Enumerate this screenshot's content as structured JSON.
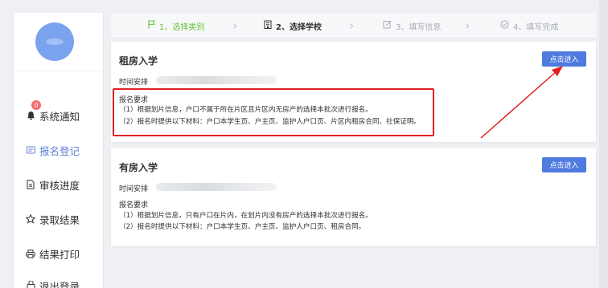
{
  "colors": {
    "accent": "#4f7be0",
    "step_done": "#67c23a",
    "badge": "#f56c6c",
    "annotation": "#e02020"
  },
  "sidebar": {
    "items": [
      {
        "label": "系统通知",
        "icon": "bell-icon",
        "badge": "0"
      },
      {
        "label": "报名登记",
        "icon": "form-icon",
        "active": true
      },
      {
        "label": "审核进度",
        "icon": "document-icon"
      },
      {
        "label": "录取结果",
        "icon": "star-icon"
      },
      {
        "label": "结果打印",
        "icon": "printer-icon"
      },
      {
        "label": "退出登录",
        "icon": "logout-icon"
      }
    ]
  },
  "steps": [
    {
      "label": "1、选择类别",
      "icon": "flag-icon",
      "status": "done"
    },
    {
      "label": "2、选择学校",
      "icon": "school-icon",
      "status": "current"
    },
    {
      "label": "3、填写信息",
      "icon": "edit-icon",
      "status": "pending"
    },
    {
      "label": "4、填写完成",
      "icon": "check-circle-icon",
      "status": "pending"
    }
  ],
  "cards": [
    {
      "title": "租房入学",
      "time_label": "时间安排",
      "req_title": "报名要求",
      "req_lines": [
        "（1）根据划片信息，户口不属于所在片区且片区内无房产的选择本批次进行报名。",
        "（2）报名时提供以下材料：户口本学生页、户主页、监护人户口页、片区内租房合同、社保证明。"
      ],
      "button": "点击进入"
    },
    {
      "title": "有房入学",
      "time_label": "时间安排",
      "req_title": "报名要求",
      "req_lines": [
        "（1）根据划片信息，只有户口在片内，在划片内没有房产的选择本批次进行报名。",
        "（2）报名时提供以下材料：户口本学生页、户主页、监护人户口页、租房合同。"
      ],
      "button": "点击进入"
    }
  ]
}
